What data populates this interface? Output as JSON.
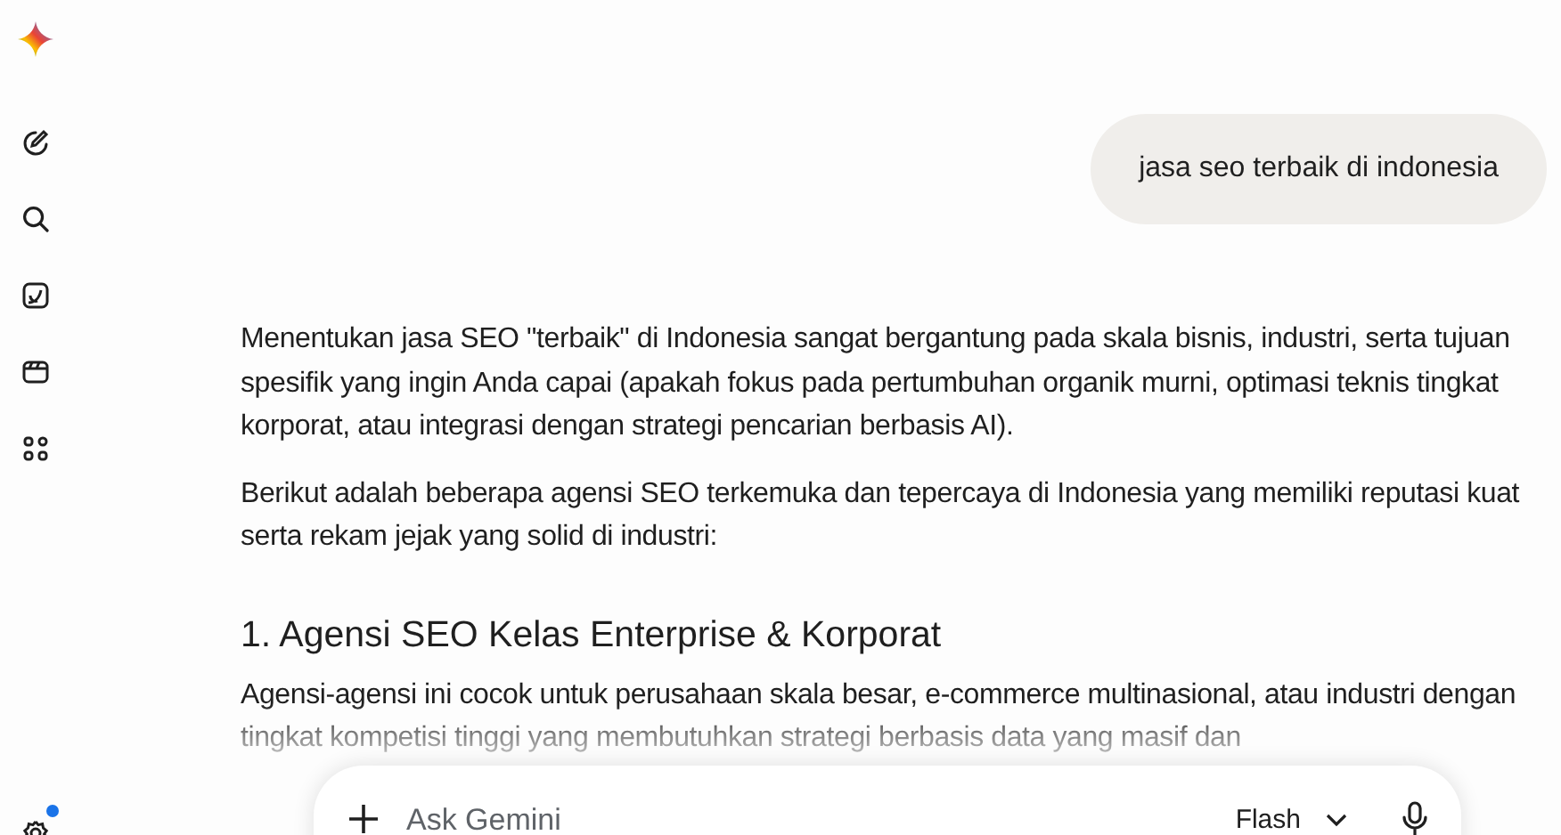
{
  "user_message": "jasa seo terbaik di indonesia",
  "response": {
    "blocks": [
      {
        "kind": "paragraph",
        "text": "Menentukan jasa SEO \"terbaik\" di Indonesia sangat bergantung pada skala bisnis, industri, serta tujuan spesifik yang ingin Anda capai (apakah fokus pada pertumbuhan organik murni, optimasi teknis tingkat korporat, atau integrasi dengan strategi pencarian berbasis AI)."
      },
      {
        "kind": "paragraph",
        "text": "Berikut adalah beberapa agensi SEO terkemuka dan tepercaya di Indonesia yang memiliki reputasi kuat serta rekam jejak yang solid di industri:"
      },
      {
        "kind": "heading",
        "text": "1. Agensi SEO Kelas Enterprise & Korporat"
      },
      {
        "kind": "paragraph",
        "text": "Agensi-agensi ini cocok untuk perusahaan skala besar, e-commerce multinasional, atau industri dengan tingkat kompetisi tinggi yang membutuhkan strategi berbasis data yang masif dan"
      }
    ]
  },
  "composer": {
    "placeholder": "Ask Gemini",
    "model": "Flash"
  },
  "settings": {
    "notification": true
  }
}
